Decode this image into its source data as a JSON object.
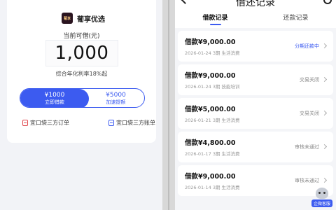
{
  "left": {
    "brand_logo_text": "葡享",
    "brand_name": "葡享优选",
    "available_label": "当前可借(元)",
    "amount": "1,000",
    "rate_text": "综合年化利率18%起",
    "toggle": {
      "left_amount": "¥1000",
      "left_label": "立即借款",
      "right_amount": "¥5000",
      "right_label": "加速提额"
    },
    "links": {
      "orders": "宜口袋三方订单",
      "bills": "宜口袋三方账单"
    }
  },
  "right": {
    "title": "借还记录",
    "tabs": [
      "借款记录",
      "还款记录"
    ],
    "records": [
      {
        "title": "借款¥9,000.00",
        "sub": "2026-01-24 3期  生活消费",
        "status": "分期还款中",
        "active": true
      },
      {
        "title": "借款¥9,000.00",
        "sub": "2026-01-24 3期  技能培训",
        "status": "交易关闭",
        "active": false
      },
      {
        "title": "借款¥5,000.00",
        "sub": "2026-01-21 3期  生活消费",
        "status": "交易关闭",
        "active": false
      },
      {
        "title": "借款¥4,800.00",
        "sub": "2026-01-17 3期  生活消费",
        "status": "审核未通过",
        "active": false
      },
      {
        "title": "借款¥9,000.00",
        "sub": "2026-01-14 3期  生活消费",
        "status": "审核未通过",
        "active": false
      }
    ],
    "support_label": "企微客服"
  },
  "colors": {
    "accent": "#3c5bf0",
    "background": "#f4f5f8"
  }
}
